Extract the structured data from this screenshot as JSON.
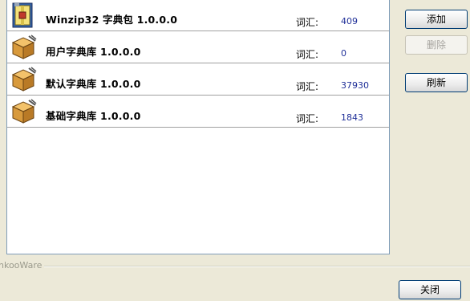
{
  "dictionaries": [
    {
      "name": "Winzip32 字典包 1.0.0.0",
      "count_label": "词汇:",
      "count": "409",
      "icon": "winzip-archive-icon"
    },
    {
      "name": "用户字典库 1.0.0.0",
      "count_label": "词汇:",
      "count": "0",
      "icon": "package-box-icon"
    },
    {
      "name": "默认字典库 1.0.0.0",
      "count_label": "词汇:",
      "count": "37930",
      "icon": "package-box-icon"
    },
    {
      "name": "基础字典库 1.0.0.0",
      "count_label": "词汇:",
      "count": "1843",
      "icon": "package-box-icon"
    }
  ],
  "buttons": {
    "add": "添加",
    "delete": "删除",
    "refresh": "刷新",
    "close": "关闭"
  },
  "footer": {
    "group_label": "nkooWare"
  },
  "colors": {
    "window_bg": "#ece9d8",
    "count_text": "#1f2f98",
    "list_border": "#7f9db9"
  }
}
